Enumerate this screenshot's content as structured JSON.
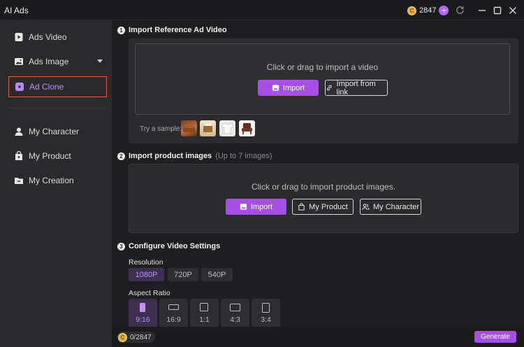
{
  "app": {
    "title": "AI Ads"
  },
  "titlebar": {
    "credits": "2847",
    "coin_symbol": "C"
  },
  "sidebar": {
    "items": [
      {
        "label": "Ads Video",
        "icon": "video-icon"
      },
      {
        "label": "Ads Image",
        "icon": "image-icon",
        "has_dropdown": true
      },
      {
        "label": "Ad Clone",
        "icon": "clone-icon",
        "active": true
      },
      {
        "label": "My Character",
        "icon": "person-icon"
      },
      {
        "label": "My Product",
        "icon": "product-icon"
      },
      {
        "label": "My Creation",
        "icon": "folder-icon"
      }
    ]
  },
  "step1": {
    "num": "1",
    "title": "Import Reference Ad Video",
    "drop_text": "Click or drag to import a video",
    "import_label": "Import",
    "import_link_label": "Import from link",
    "sample_label": "Try a sample:"
  },
  "step2": {
    "num": "2",
    "title": "Import product images",
    "subtitle": "(Up to 7 images)",
    "drop_text": "Click or drag to import product images.",
    "import_label": "Import",
    "my_product_label": "My Product",
    "my_character_label": "My Character"
  },
  "step3": {
    "num": "3",
    "title": "Configure Video Settings",
    "resolution_label": "Resolution",
    "resolutions": [
      "1080P",
      "720P",
      "540P"
    ],
    "selected_resolution": "1080P",
    "aspect_label": "Aspect Ratio",
    "aspect_ratios": [
      "9:16",
      "16:9",
      "1:1",
      "4:3",
      "3:4"
    ],
    "selected_aspect": "9:16"
  },
  "footer": {
    "credit_text": "0/2847",
    "generate_label": "Generate"
  },
  "colors": {
    "accent": "#a64ee6",
    "active_border": "#e05a46",
    "coin": "#e1b04a"
  }
}
